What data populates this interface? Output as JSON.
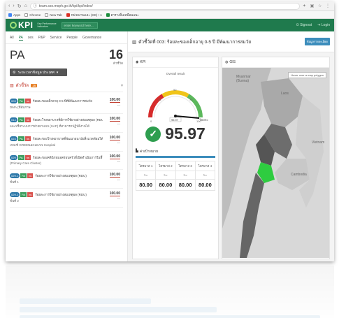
{
  "browser": {
    "url": "team.sso.moph.go.th/kpi/kpi/index/",
    "bookmarks": [
      "Apps",
      "Chrome",
      "New Tab",
      "หน่วยงานและ (KD) • s",
      "ตารางอื่นเหมือนแนะ"
    ]
  },
  "appbar": {
    "logo": "KPI",
    "logo_sub": "Key Performance Indicators",
    "search_placeholder": "enter keyword here...",
    "signout": "Signout",
    "login": "Login"
  },
  "tabs": [
    "All",
    "PA",
    "ses",
    "P&P",
    "Service",
    "People",
    "Governance"
  ],
  "active_tab": "PA",
  "left": {
    "title": "PA",
    "count": "16",
    "count_label": "ตัวชี้วัด",
    "dropdown_label": "ระยะเวลาข้อมูล ประเทศ",
    "indicators_heading": "ตัวชี้วัด",
    "indicators_badge": "16",
    "items": [
      {
        "code": "003",
        "text": "ร้อยละของเด็กอายุ 0-5 ปีที่มีพัฒนาการสมวัย",
        "sub": "DMA (ที่สัมภาษ",
        "score": "100.00",
        "date": "..."
      },
      {
        "code": "014",
        "text": "ร้อยละโรงพยาบาลที่มีการใช้ยาอย่างสมเหตุผล (RDU)",
        "sub": "และหรือระบบการจ่ายยาแบบ (SAP) ที่สามารถปฏิบัติงานได้",
        "score": "100.00",
        "date": "..."
      },
      {
        "code": "023",
        "text": "ร้อยละของโรงพยาบาลที่พัฒนาอนามัยสิ่งแวดล้อมได้ตาม",
        "sub": "เกณฑ์ GREEN&CLEAN Hospital",
        "score": "100.00",
        "date": "..."
      },
      {
        "code": "029",
        "text": "ร้อยละของคลินิกหมอครอบครัวที่เปิดดำเนินการในพื้นที่",
        "sub": "(Primary Care Cluster)",
        "score": "100.00",
        "date": "..."
      },
      {
        "code": "029.1",
        "text": "ร้อยละการใช้ยาอย่างสมเหตุผล (RDU)",
        "sub": "ขั้นที่ 1",
        "score": "100.00",
        "date": "..."
      },
      {
        "code": "029.2",
        "text": "ร้อยละการใช้ยาอย่างสมเหตุผล (RDU)",
        "sub": "ขั้นที่ 2",
        "score": "100.00",
        "date": "..."
      }
    ],
    "tag_pa": "PA",
    "tag_ns": "ns"
  },
  "main": {
    "kpi_title": "ตัวชี้วัดที่ 003: ร้อยละของเด็กอายุ 0-5 ปี มีพัฒนาการสมวัย",
    "button": "ข้อมูลรายละเอียด",
    "kpi_card_title": "KPI",
    "gis_card_title": "GIS",
    "overall_label": "Overall result",
    "gauge_value": "95.97",
    "result_value": "95.97",
    "result_label": "ร้อยละ",
    "target_heading": "ค่าเป้าหมาย",
    "quarters": [
      "ไตรมาส 1",
      "ไตรมาส 2",
      "ไตรมาส 3",
      "ไตรมาส 4"
    ],
    "quarter_op": ">=",
    "quarter_values": [
      "80.00",
      "80.00",
      "80.00",
      "80.00"
    ],
    "map_tooltip": "Hover over a map polygon",
    "map_labels": [
      "Myanmar (Burma)",
      "Laos",
      "Vietnam",
      "Cambodia"
    ],
    "gauge_ticks": [
      "0",
      "25",
      "50",
      "75",
      "100"
    ]
  }
}
